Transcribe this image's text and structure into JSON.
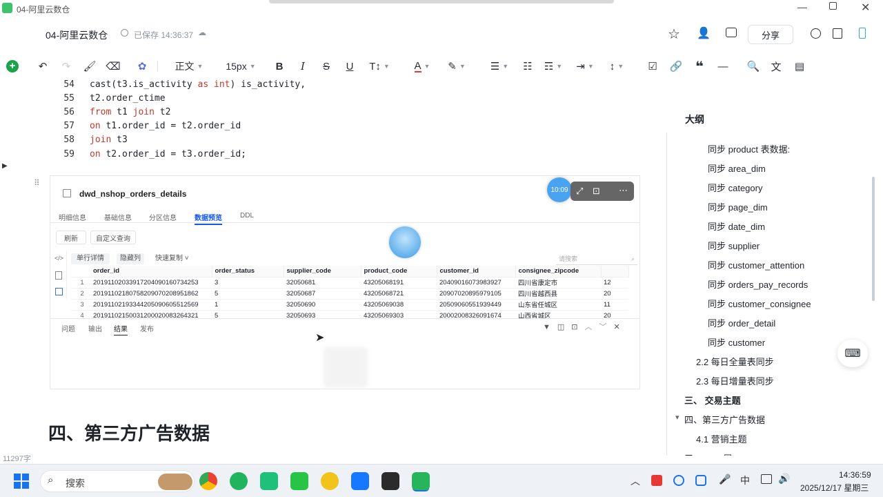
{
  "window": {
    "title": "04-阿里云数仓"
  },
  "header": {
    "doc_title": "04-阿里云数仓",
    "saved_status": "已保存 14:36:37",
    "share_label": "分享"
  },
  "toolbar": {
    "text_style": "正文",
    "font_size": "15px"
  },
  "code": {
    "lines": [
      {
        "num": "54",
        "parts": [
          {
            "t": "cast(t3.is_activity "
          },
          {
            "t": "as",
            "k": true
          },
          {
            "t": " "
          },
          {
            "t": "int",
            "k": true
          },
          {
            "t": ") is_activity,"
          }
        ]
      },
      {
        "num": "55",
        "parts": [
          {
            "t": "t2.order_ctime"
          }
        ]
      },
      {
        "num": "56",
        "parts": [
          {
            "t": "from",
            "k": true
          },
          {
            "t": " t1 "
          },
          {
            "t": "join",
            "k": true
          },
          {
            "t": " t2"
          }
        ]
      },
      {
        "num": "57",
        "parts": [
          {
            "t": "on",
            "k": true
          },
          {
            "t": " t1.order_id = t2.order_id"
          }
        ]
      },
      {
        "num": "58",
        "parts": [
          {
            "t": "join",
            "k": true
          },
          {
            "t": " t3"
          }
        ]
      },
      {
        "num": "59",
        "parts": [
          {
            "t": "on",
            "k": true
          },
          {
            "t": " t2.order_id = t3.order_id;"
          }
        ]
      }
    ]
  },
  "embed": {
    "table_name": "dwd_nshop_orders_details",
    "time_badge": "10:09",
    "tabs": [
      "明细信息",
      "基础信息",
      "分区信息",
      "数据预览",
      "DDL"
    ],
    "active_tab": "数据预览",
    "refresh_label": "刷新",
    "custom_query_label": "自定义查询",
    "row_detail_label": "单行详情",
    "hide_col_label": "隐藏列",
    "quick_copy_label": "快速复制",
    "search_placeholder": "请搜索",
    "columns": [
      "order_id",
      "order_status",
      "supplier_code",
      "product_code",
      "customer_id",
      "consignee_zipcode",
      ""
    ],
    "rows": [
      [
        "1",
        "20191102033917204090160734253",
        "3",
        "32050681",
        "43205068191",
        "20409016073983927",
        "四川省康定市",
        "12"
      ],
      [
        "2",
        "20191102180758209070208951862",
        "5",
        "32050687",
        "43205068721",
        "20907020895979105",
        "四川省越西县",
        "20"
      ],
      [
        "3",
        "20191102193344205090605512569",
        "1",
        "32050690",
        "43205069038",
        "20509060551939449",
        "山东省任城区",
        "11"
      ],
      [
        "4",
        "20191102150031200020083264321",
        "5",
        "32050693",
        "43205069303",
        "20002008326091674",
        "山西省城区",
        "20"
      ]
    ],
    "bottom_tabs": [
      "问题",
      "输出",
      "结果",
      "发布"
    ],
    "active_bottom_tab": "结果"
  },
  "heading": "四、第三方广告数据",
  "word_count": "11297字",
  "outline": {
    "title": "大纲",
    "items": [
      {
        "label": "同步 product 表数据:",
        "level": 3
      },
      {
        "label": "同步 area_dim",
        "level": 3
      },
      {
        "label": "同步 category",
        "level": 3
      },
      {
        "label": "同步 page_dim",
        "level": 3
      },
      {
        "label": "同步 date_dim",
        "level": 3
      },
      {
        "label": "同步 supplier",
        "level": 3
      },
      {
        "label": "同步 customer_attention",
        "level": 3
      },
      {
        "label": "同步 orders_pay_records",
        "level": 3
      },
      {
        "label": "同步 customer_consignee",
        "level": 3
      },
      {
        "label": "同步 order_detail",
        "level": 3
      },
      {
        "label": "同步 customer",
        "level": 3
      },
      {
        "label": "2.2 每日全量表同步",
        "level": 2
      },
      {
        "label": "2.3 每日增量表同步",
        "level": 2
      },
      {
        "label": "三、 交易主题",
        "level": 1
      },
      {
        "label": "四、第三方广告数据",
        "level": 1
      },
      {
        "label": "4.1 营销主题",
        "level": 2
      },
      {
        "label": "五、DWS层",
        "level": 1
      }
    ]
  },
  "taskbar": {
    "search_label": "搜索",
    "time": "14:36:59",
    "date": "2025/12/17 星期三"
  },
  "colors": {
    "accent": "#1456f0",
    "green": "#1aa34a",
    "keyword": "#c0392b"
  }
}
